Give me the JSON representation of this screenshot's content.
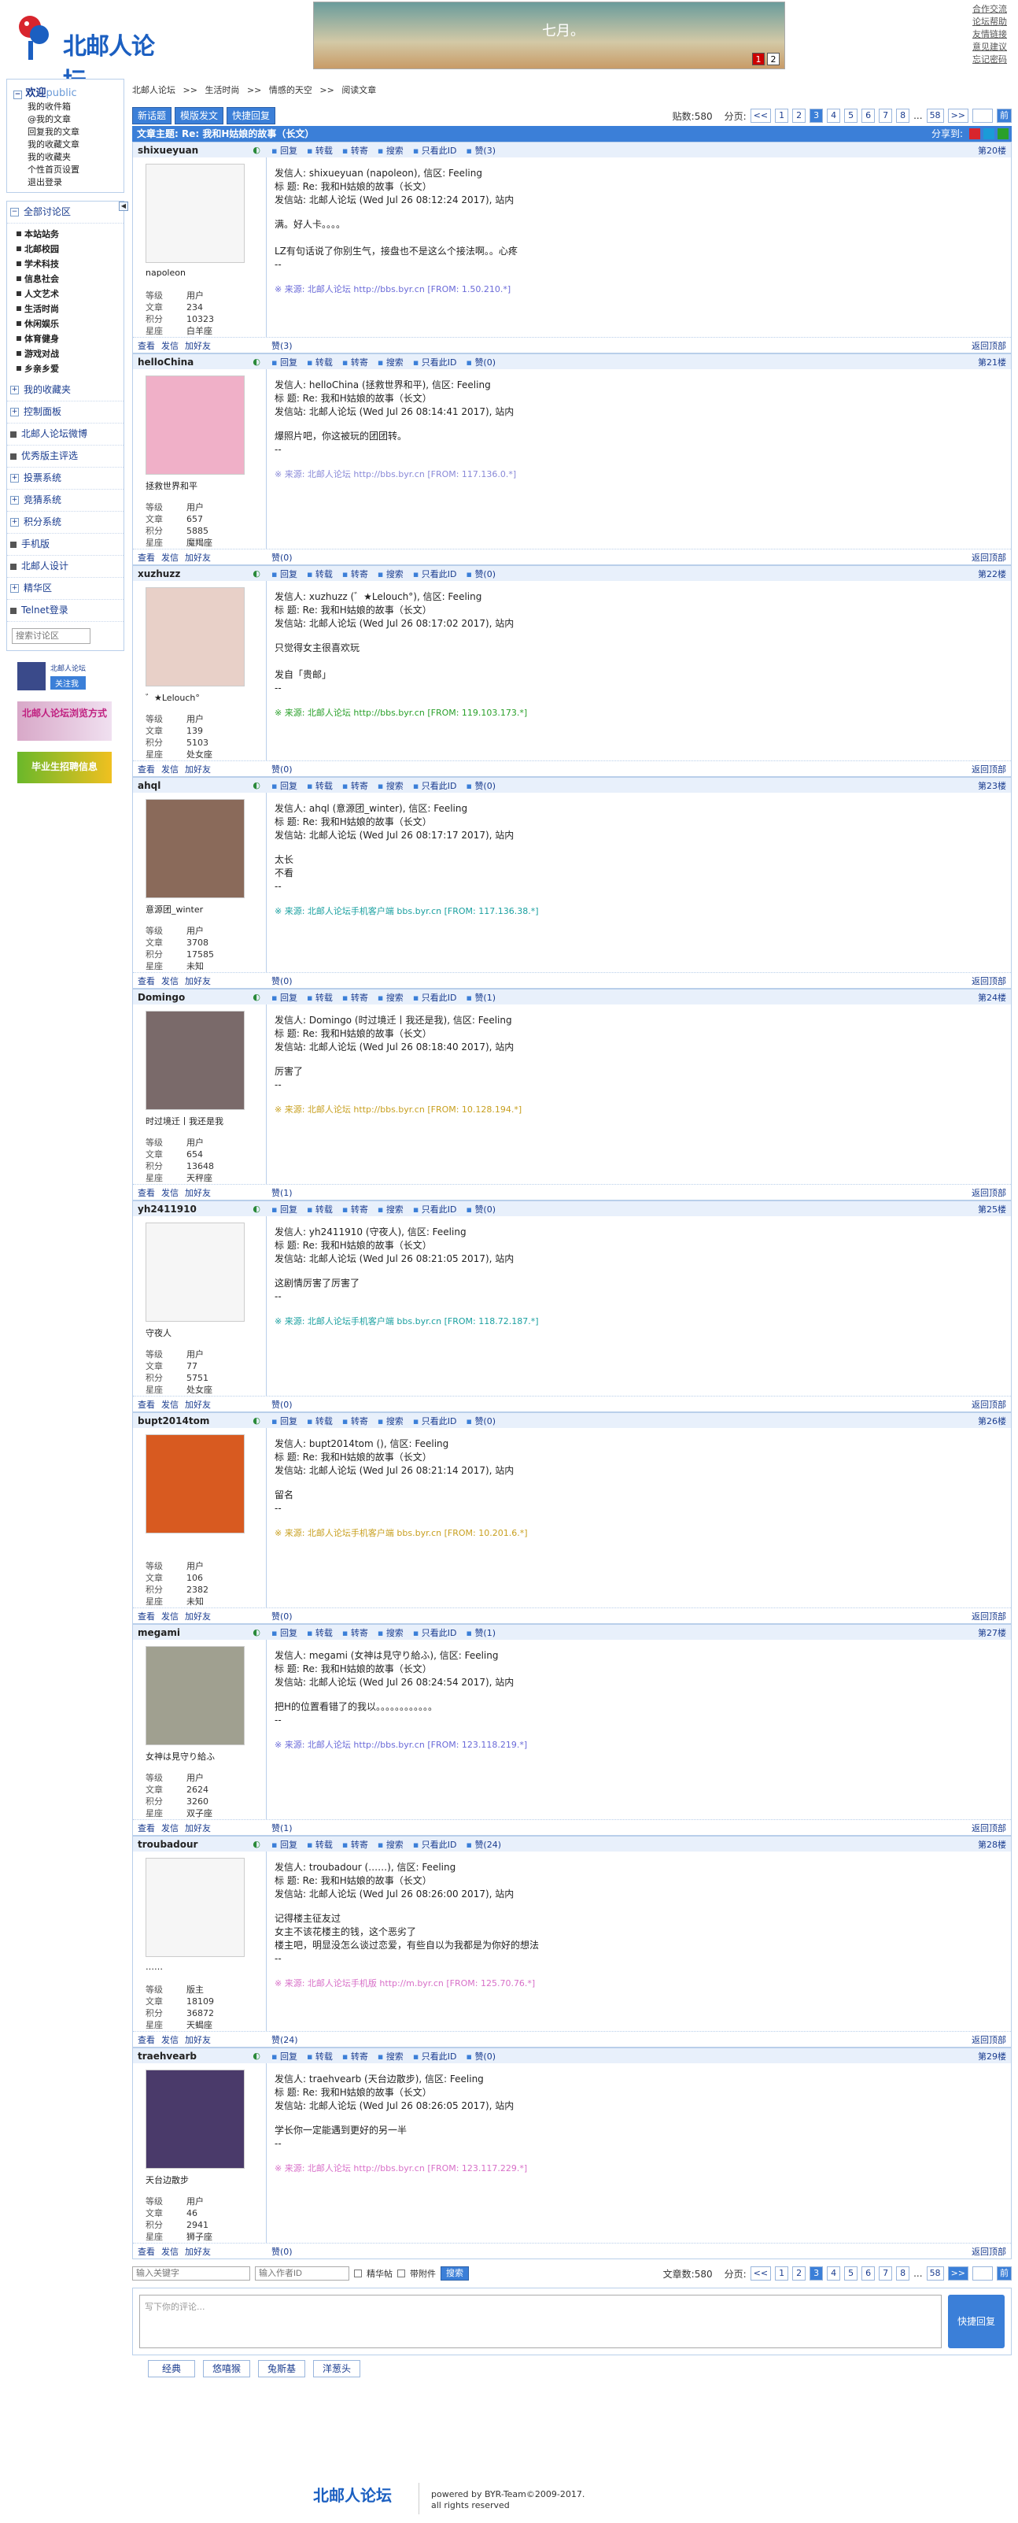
{
  "header": {
    "logo_text": "北邮人论坛",
    "banner_text": "七月。",
    "banner_dots": [
      "1",
      "2"
    ],
    "top_links": [
      "合作交流",
      "论坛帮助",
      "友情链接",
      "意见建议",
      "忘记密码"
    ]
  },
  "sidebar": {
    "welcome": "欢迎",
    "welcome_user": "public",
    "user_links": [
      "我的收件箱",
      "@我的文章",
      "回复我的文章",
      "我的收藏文章",
      "我的收藏夹",
      "个性首页设置",
      "退出登录"
    ],
    "all_boards": "全部讨论区",
    "boards": [
      "本站站务",
      "北邮校园",
      "学术科技",
      "信息社会",
      "人文艺术",
      "生活时尚",
      "休闲娱乐",
      "体育健身",
      "游戏对战",
      "乡亲乡爱"
    ],
    "items": [
      "我的收藏夹",
      "控制面板",
      "北邮人论坛微博",
      "优秀版主评选",
      "投票系统",
      "竞猜系统",
      "积分系统",
      "手机版",
      "北邮人设计",
      "精华区",
      "Telnet登录"
    ],
    "search_placeholder": "搜索讨论区",
    "promo1": "北邮人论坛",
    "promo1_btn": "关注我",
    "promo2": "北邮人论坛浏览方式",
    "promo3": "毕业生招聘信息"
  },
  "breadcrumb": [
    "北邮人论坛",
    ">>",
    "生活时尚",
    ">>",
    "情感的天空",
    ">>",
    "阅读文章"
  ],
  "toolbar": {
    "new_topic": "新话题",
    "new_topic_in_board": "模版发文",
    "quick_reply": "快捷回复",
    "post_count": "贴数:580",
    "page_label": "分页:",
    "pages": [
      "<<",
      "1",
      "2",
      "3",
      "4",
      "5",
      "6",
      "7",
      "8",
      "...",
      "58",
      ">>"
    ],
    "current_page": "3",
    "go": "前"
  },
  "topic": {
    "title": "文章主题: Re: 我和H姑娘的故事（长文）",
    "share": "分享到:"
  },
  "labels": {
    "reply": "回复",
    "forward": "转载",
    "repost": "转寄",
    "search": "搜索",
    "only_author": "只看此ID",
    "view": "查看",
    "msg": "发信",
    "add_friend": "加好友",
    "back_top": "返回顶部",
    "level": "等级",
    "posts": "文章",
    "score": "积分",
    "zodiac": "星座",
    "from_label": "来源:"
  },
  "posts": [
    {
      "user": "shixueyuan",
      "nick": "napoleon",
      "level": "用户",
      "posts": "234",
      "score": "10323",
      "zodiac": "白羊座",
      "floor": "第20楼",
      "likes": "赞(3)",
      "meta": [
        "发信人: shixueyuan (napoleon), 信区: Feeling",
        "标  题: Re: 我和H姑娘的故事（长文）",
        "发信站: 北邮人论坛 (Wed Jul 26 08:12:24 2017), 站内"
      ],
      "content": [
        "满。好人卡。。。。",
        "",
        "LZ有句话说了你别生气，接盘也不是这么个接法啊。。心疼",
        "--"
      ],
      "source": "※ 来源: 北邮人论坛 http://bbs.byr.cn [FROM: 1.50.210.*]",
      "src_color": "#6a6ad8"
    },
    {
      "user": "helloChina",
      "nick": "拯救世界和平",
      "level": "用户",
      "posts": "657",
      "score": "5885",
      "zodiac": "魔羯座",
      "floor": "第21楼",
      "likes": "赞(0)",
      "meta": [
        "发信人: helloChina (拯救世界和平), 信区: Feeling",
        "标  题: Re: 我和H姑娘的故事（长文）",
        "发信站: 北邮人论坛 (Wed Jul 26 08:14:41 2017), 站内"
      ],
      "content": [
        "爆照片吧，你这被玩的团团转。",
        "--"
      ],
      "source": "※ 来源: 北邮人论坛 http://bbs.byr.cn [FROM: 117.136.0.*]",
      "src_color": "#8a8ad8"
    },
    {
      "user": "xuzhuzz",
      "nick": "゛★Lelouch°",
      "level": "用户",
      "posts": "139",
      "score": "5103",
      "zodiac": "处女座",
      "floor": "第22楼",
      "likes": "赞(0)",
      "meta": [
        "发信人: xuzhuzz (゛★Lelouch°), 信区: Feeling",
        "标  题: Re: 我和H姑娘的故事（长文）",
        "发信站: 北邮人论坛 (Wed Jul 26 08:17:02 2017), 站内"
      ],
      "content": [
        "只觉得女主很喜欢玩",
        "",
        "发自「贵邮」",
        "--"
      ],
      "source": "※ 来源: 北邮人论坛 http://bbs.byr.cn [FROM: 119.103.173.*]",
      "src_color": "#2aa02a"
    },
    {
      "user": "ahql",
      "nick": "意源团_winter",
      "level": "用户",
      "posts": "3708",
      "score": "17585",
      "zodiac": "未知",
      "floor": "第23楼",
      "likes": "赞(0)",
      "meta": [
        "发信人: ahql (意源团_winter), 信区: Feeling",
        "标  题: Re: 我和H姑娘的故事（长文）",
        "发信站: 北邮人论坛 (Wed Jul 26 08:17:17 2017), 站内"
      ],
      "content": [
        "太长",
        "不看",
        "--"
      ],
      "source": "※ 来源: 北邮人论坛手机客户端 bbs.byr.cn [FROM: 117.136.38.*]",
      "src_color": "#1aa0a0"
    },
    {
      "user": "Domingo",
      "nick": "时过境迁丨我还是我",
      "level": "用户",
      "posts": "654",
      "score": "13648",
      "zodiac": "天秤座",
      "floor": "第24楼",
      "likes": "赞(1)",
      "meta": [
        "发信人: Domingo (时过境迁丨我还是我), 信区: Feeling",
        "标  题: Re: 我和H姑娘的故事（长文）",
        "发信站: 北邮人论坛 (Wed Jul 26 08:18:40 2017), 站内"
      ],
      "content": [
        "厉害了",
        "--"
      ],
      "source": "※ 来源: 北邮人论坛 http://bbs.byr.cn [FROM: 10.128.194.*]",
      "src_color": "#c8a020"
    },
    {
      "user": "yh2411910",
      "nick": "守夜人",
      "level": "用户",
      "posts": "77",
      "score": "5751",
      "zodiac": "处女座",
      "floor": "第25楼",
      "likes": "赞(0)",
      "meta": [
        "发信人: yh2411910 (守夜人), 信区: Feeling",
        "标  题: Re: 我和H姑娘的故事（长文）",
        "发信站: 北邮人论坛 (Wed Jul 26 08:21:05 2017), 站内"
      ],
      "content": [
        "这剧情厉害了厉害了",
        "--"
      ],
      "source": "※ 来源: 北邮人论坛手机客户端 bbs.byr.cn [FROM: 118.72.187.*]",
      "src_color": "#1aa0a0"
    },
    {
      "user": "bupt2014tom",
      "nick": "",
      "level": "用户",
      "posts": "106",
      "score": "2382",
      "zodiac": "未知",
      "floor": "第26楼",
      "likes": "赞(0)",
      "meta": [
        "发信人: bupt2014tom (), 信区: Feeling",
        "标  题: Re: 我和H姑娘的故事（长文）",
        "发信站: 北邮人论坛 (Wed Jul 26 08:21:14 2017), 站内"
      ],
      "content": [
        "留名",
        "--"
      ],
      "source": "※ 来源: 北邮人论坛手机客户端 bbs.byr.cn [FROM: 10.201.6.*]",
      "src_color": "#c8a020"
    },
    {
      "user": "megami",
      "nick": "女神は見守り給ふ",
      "level": "用户",
      "posts": "2624",
      "score": "3260",
      "zodiac": "双子座",
      "floor": "第27楼",
      "likes": "赞(1)",
      "meta": [
        "发信人: megami (女神は見守り給ふ), 信区: Feeling",
        "标  题: Re: 我和H姑娘的故事（长文）",
        "发信站: 北邮人论坛 (Wed Jul 26 08:24:54 2017), 站内"
      ],
      "content": [
        "把H的位置看错了的我以。。。。。。。。。。。。",
        "--"
      ],
      "source": "※ 来源: 北邮人论坛 http://bbs.byr.cn [FROM: 123.118.219.*]",
      "src_color": "#6a6ad8"
    },
    {
      "user": "troubadour",
      "nick": "……",
      "level": "版主",
      "posts": "18109",
      "score": "36872",
      "zodiac": "天蝎座",
      "floor": "第28楼",
      "likes": "赞(24)",
      "meta": [
        "发信人: troubadour (……), 信区: Feeling",
        "标  题: Re: 我和H姑娘的故事（长文）",
        "发信站: 北邮人论坛 (Wed Jul 26 08:26:00 2017), 站内"
      ],
      "content": [
        "记得楼主征友过",
        "女主不该花楼主的钱，这个恶劣了",
        "楼主吧，明显没怎么谈过恋爱，有些自以为我都是为你好的想法",
        "--"
      ],
      "source": "※ 来源: 北邮人论坛手机版 http://m.byr.cn [FROM: 125.70.76.*]",
      "src_color": "#d870c8"
    },
    {
      "user": "traehvearb",
      "nick": "天台边散步",
      "level": "用户",
      "posts": "46",
      "score": "2941",
      "zodiac": "狮子座",
      "floor": "第29楼",
      "likes": "赞(0)",
      "meta": [
        "发信人: traehvearb (天台边散步), 信区: Feeling",
        "标  题: Re: 我和H姑娘的故事（长文）",
        "发信站: 北邮人论坛 (Wed Jul 26 08:26:05 2017), 站内"
      ],
      "content": [
        "学长你一定能遇到更好的另一半",
        "--"
      ],
      "source": "※ 来源: 北邮人论坛 http://bbs.byr.cn [FROM: 123.117.229.*]",
      "src_color": "#d870c8"
    }
  ],
  "bottom": {
    "kw_placeholder": "输入关键字",
    "author_placeholder": "输入作者ID",
    "digest": "精华帖",
    "attach": "带附件",
    "search_btn": "搜索",
    "post_count": "文章数:580",
    "page_label": "分页:"
  },
  "reply": {
    "placeholder": "写下你的评论...",
    "submit": "快捷回复",
    "emoji_tabs": [
      "经典",
      "悠嘻猴",
      "兔斯基",
      "洋葱头"
    ]
  },
  "footer": {
    "logo": "北邮人论坛",
    "line1": "powered by BYR-Team©2009-2017.",
    "line2": "all rights reserved"
  },
  "colors": {
    "accent": "#3b7fd8",
    "border": "#b9cfea"
  }
}
